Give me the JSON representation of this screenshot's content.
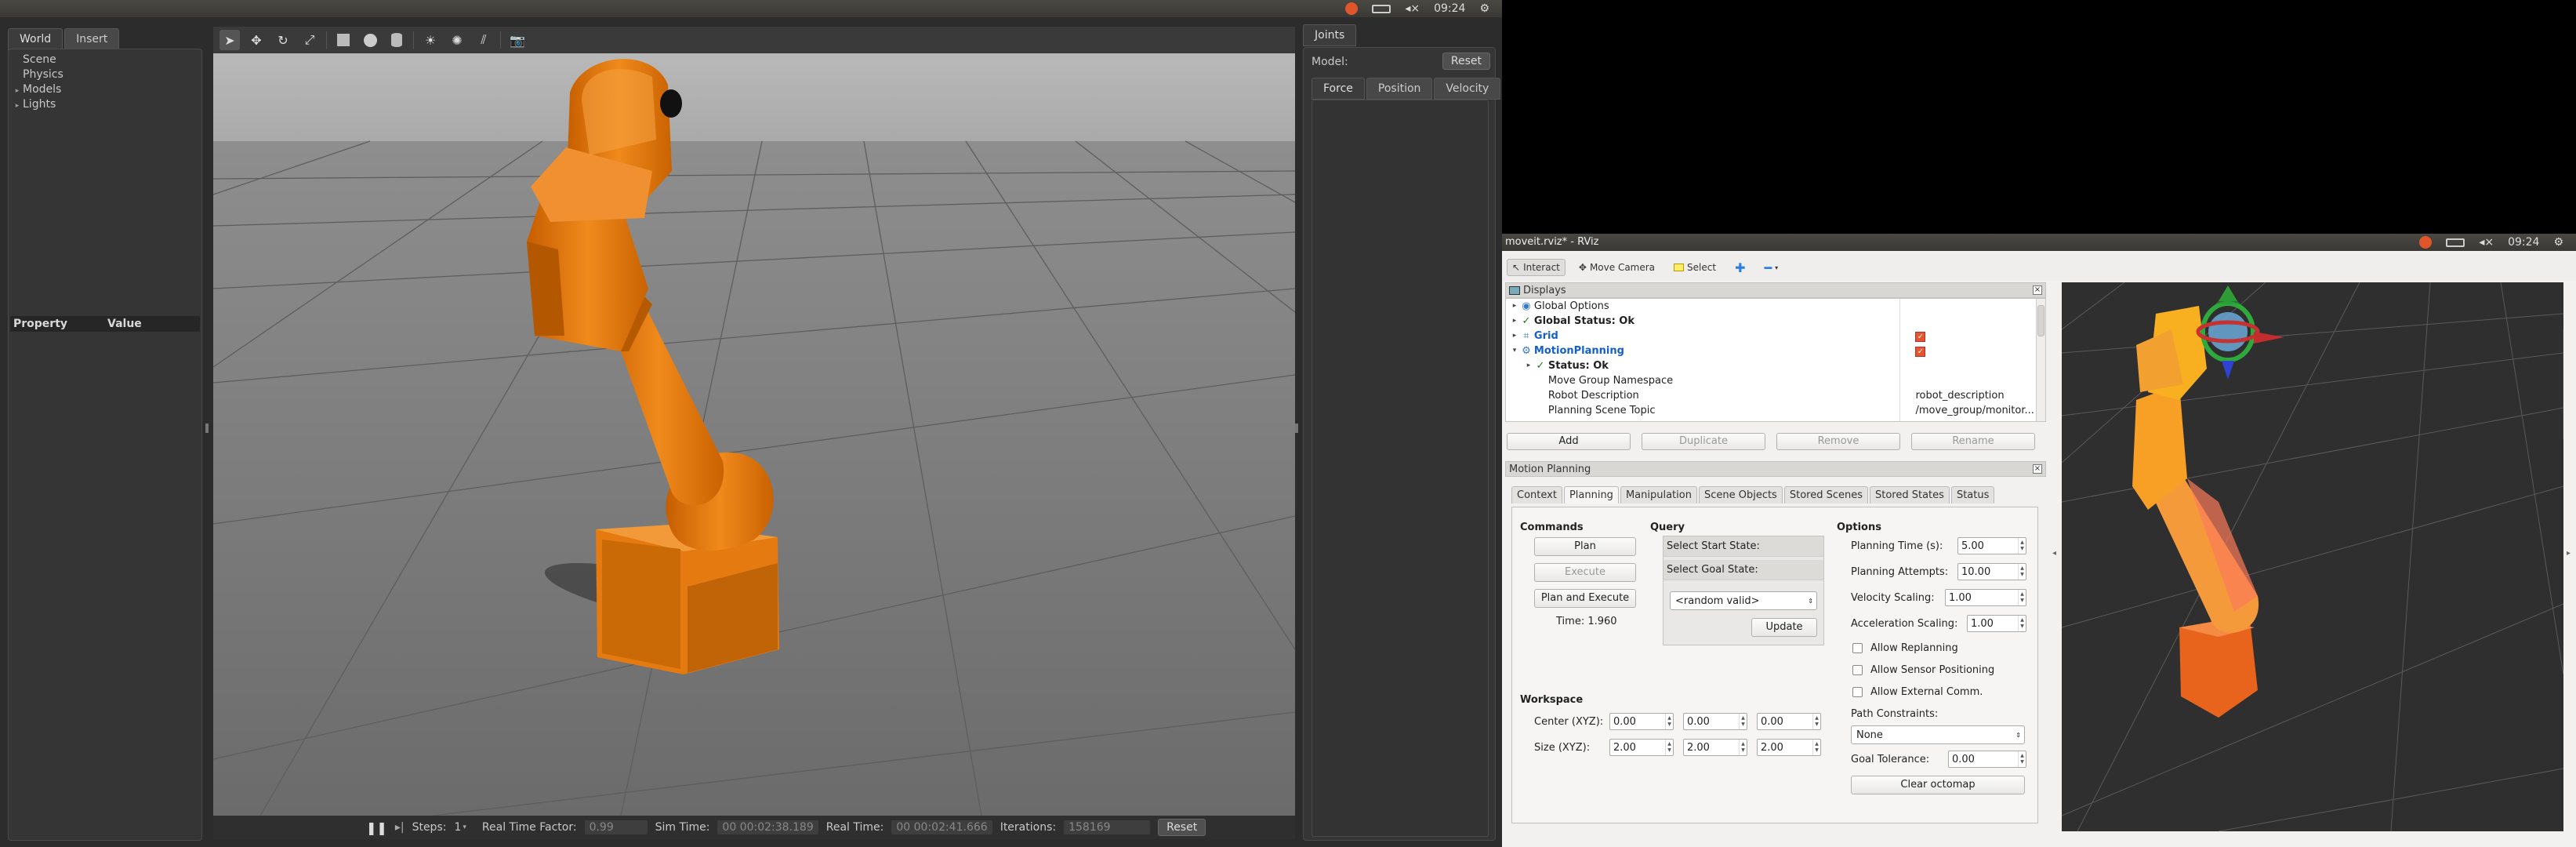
{
  "gazebo": {
    "system_bar": {
      "time": "09:24"
    },
    "left_panel": {
      "tabs": [
        "World",
        "Insert"
      ],
      "tree": [
        "Scene",
        "Physics",
        "Models",
        "Lights"
      ],
      "property_header": {
        "property": "Property",
        "value": "Value"
      }
    },
    "toolbar": {
      "tools": [
        "select-arrow-icon",
        "translate-icon",
        "rotate-icon",
        "scale-icon",
        "box-icon",
        "sphere-icon",
        "cylinder-icon",
        "sun-light-icon",
        "point-light-icon",
        "spot-light-icon",
        "camera-screenshot-icon"
      ]
    },
    "bottom_bar": {
      "steps_label": "Steps:",
      "steps_value": "1",
      "real_time_factor_label": "Real Time Factor:",
      "real_time_factor_value": "0.99",
      "sim_time_label": "Sim Time:",
      "sim_time_value": "00 00:02:38.189",
      "real_time_label": "Real Time:",
      "real_time_value": "00 00:02:41.666",
      "iterations_label": "Iterations:",
      "iterations_value": "158169",
      "reset_label": "Reset"
    },
    "joints_panel": {
      "tab": "Joints",
      "model_label": "Model:",
      "reset_label": "Reset",
      "subtabs": [
        "Force",
        "Position",
        "Velocity"
      ]
    }
  },
  "rviz": {
    "system_bar": {
      "time": "09:24"
    },
    "title": "moveit.rviz* - RViz",
    "toolbar": {
      "interact": "Interact",
      "move_camera": "Move Camera",
      "select": "Select"
    },
    "displays": {
      "title": "Displays",
      "rows": [
        {
          "label": "Global Options",
          "indent": 0,
          "arrow": "▸",
          "value": ""
        },
        {
          "label": "Global Status: Ok",
          "indent": 0,
          "arrow": "▸",
          "value": "",
          "bold": true,
          "check": true
        },
        {
          "label": "Grid",
          "indent": 0,
          "arrow": "▸",
          "value": "",
          "blue": true,
          "checked": true
        },
        {
          "label": "MotionPlanning",
          "indent": 0,
          "arrow": "▾",
          "value": "",
          "blue": true,
          "checked": true
        },
        {
          "label": "Status: Ok",
          "indent": 1,
          "arrow": "▸",
          "value": "",
          "bold": true,
          "check": true
        },
        {
          "label": "Move Group Namespace",
          "indent": 1,
          "arrow": "",
          "value": ""
        },
        {
          "label": "Robot Description",
          "indent": 1,
          "arrow": "",
          "value": "robot_description"
        },
        {
          "label": "Planning Scene Topic",
          "indent": 1,
          "arrow": "",
          "value": "/move_group/monitor..."
        }
      ],
      "buttons": [
        "Add",
        "Duplicate",
        "Remove",
        "Rename"
      ]
    },
    "motion_planning": {
      "title": "Motion Planning",
      "tabs": [
        "Context",
        "Planning",
        "Manipulation",
        "Scene Objects",
        "Stored Scenes",
        "Stored States",
        "Status"
      ],
      "active_tab": "Planning",
      "commands": {
        "title": "Commands",
        "plan": "Plan",
        "execute": "Execute",
        "plan_and_execute": "Plan and Execute",
        "time": "Time: 1.960"
      },
      "query": {
        "title": "Query",
        "start_state": "Select Start State:",
        "goal_state": "Select Goal State:",
        "goal_value": "<random valid>",
        "update": "Update"
      },
      "options": {
        "title": "Options",
        "planning_time_label": "Planning Time (s):",
        "planning_time": "5.00",
        "planning_attempts_label": "Planning Attempts:",
        "planning_attempts": "10.00",
        "velocity_scaling_label": "Velocity Scaling:",
        "velocity_scaling": "1.00",
        "acceleration_scaling_label": "Acceleration Scaling:",
        "acceleration_scaling": "1.00",
        "allow_replanning": "Allow Replanning",
        "allow_sensor_positioning": "Allow Sensor Positioning",
        "allow_external_comm": "Allow External Comm.",
        "path_constraints_label": "Path Constraints:",
        "path_constraints": "None",
        "goal_tolerance_label": "Goal Tolerance:",
        "goal_tolerance": "0.00",
        "clear_octomap": "Clear octomap"
      },
      "workspace": {
        "title": "Workspace",
        "center_label": "Center (XYZ):",
        "center": [
          "0.00",
          "0.00",
          "0.00"
        ],
        "size_label": "Size (XYZ):",
        "size": [
          "2.00",
          "2.00",
          "2.00"
        ]
      }
    }
  }
}
